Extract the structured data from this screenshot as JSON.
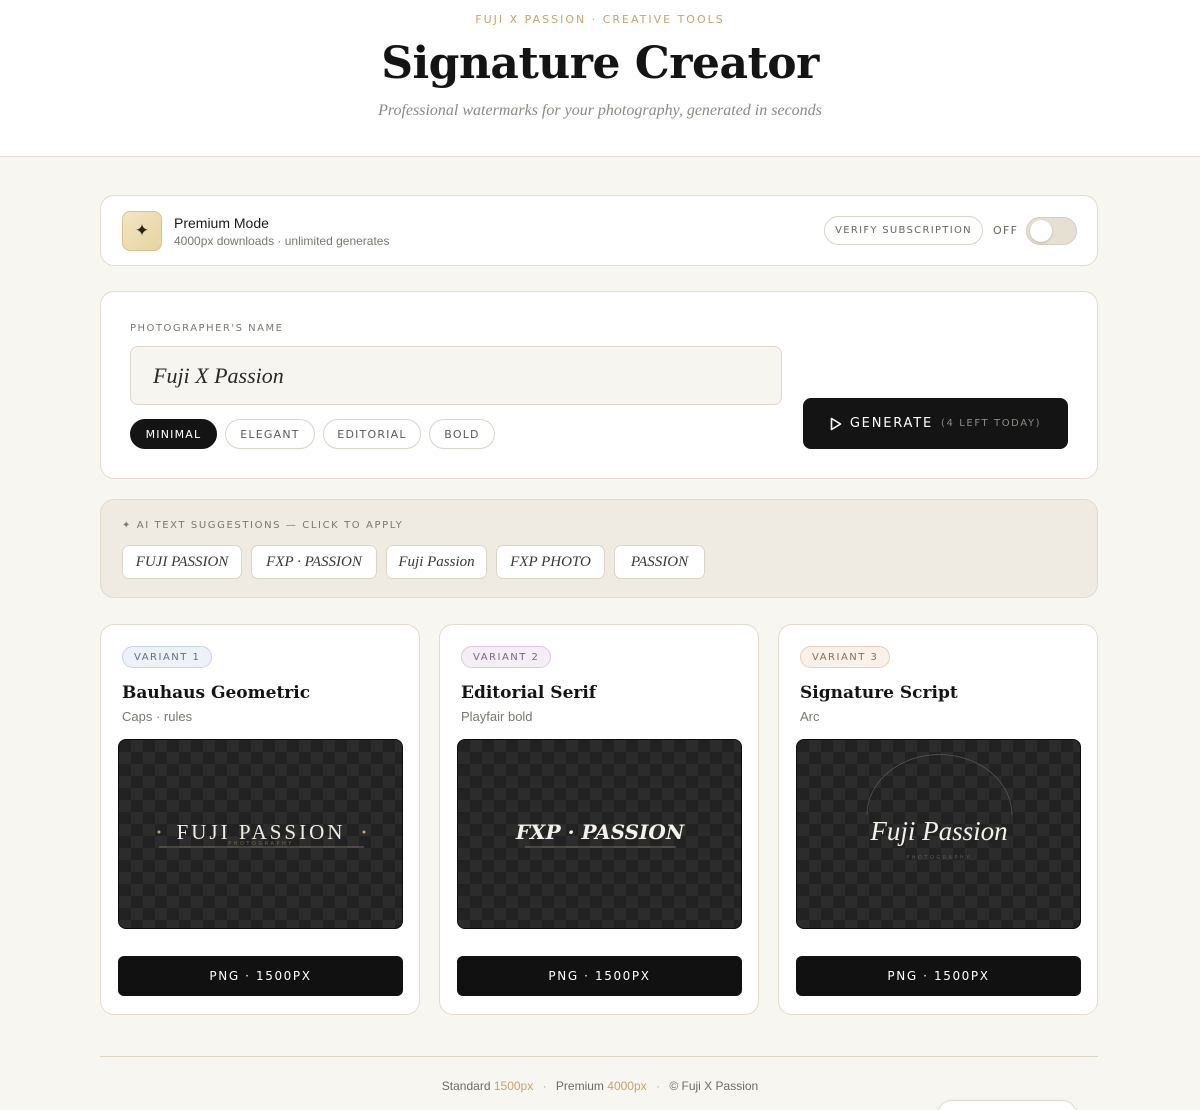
{
  "header": {
    "eyebrow": "FUJI X PASSION · CREATIVE TOOLS",
    "title": "Signature Creator",
    "subtitle": "Professional watermarks for your photography, generated in seconds"
  },
  "premium": {
    "icon": "sparkle-icon",
    "title": "Premium Mode",
    "subtitle": "4000px downloads · unlimited generates",
    "verify_label": "VERIFY SUBSCRIPTION",
    "toggle_state": "OFF"
  },
  "name_card": {
    "label": "PHOTOGRAPHER'S NAME",
    "name_value": "Fuji X Passion",
    "styles": [
      "MINIMAL",
      "ELEGANT",
      "EDITORIAL",
      "BOLD"
    ],
    "active_style": "MINIMAL",
    "generate_label": "GENERATE",
    "generate_remaining": "(4 LEFT TODAY)"
  },
  "suggestions": {
    "label": "✦ AI TEXT SUGGESTIONS — CLICK TO APPLY",
    "items": [
      "FUJI PASSION",
      "FXP · PASSION",
      "Fuji Passion",
      "FXP PHOTO",
      "PASSION"
    ]
  },
  "variants": [
    {
      "badge": "VARIANT 1",
      "name": "Bauhaus Geometric",
      "desc": "Caps · rules",
      "preview_text": "FUJI PASSION",
      "preview_subtext": "PHOTOGRAPHY",
      "download_label": "PNG · 1500PX"
    },
    {
      "badge": "VARIANT 2",
      "name": "Editorial Serif",
      "desc": "Playfair bold",
      "preview_text": "FXP · PASSION",
      "download_label": "PNG · 1500PX"
    },
    {
      "badge": "VARIANT 3",
      "name": "Signature Script",
      "desc": "Arc",
      "preview_text": "Fuji Passion",
      "preview_subtext": "PHOTOGRAPHY",
      "download_label": "PNG · 1500PX"
    }
  ],
  "footer": {
    "standard_label": "Standard",
    "standard_value": "1500px",
    "premium_label": "Premium",
    "premium_value": "4000px",
    "copyright": "© Fuji X Passion"
  },
  "colors": {
    "accent_gold": "#c3a66a",
    "background": "#f8f6f1",
    "button_dark": "#141414"
  }
}
